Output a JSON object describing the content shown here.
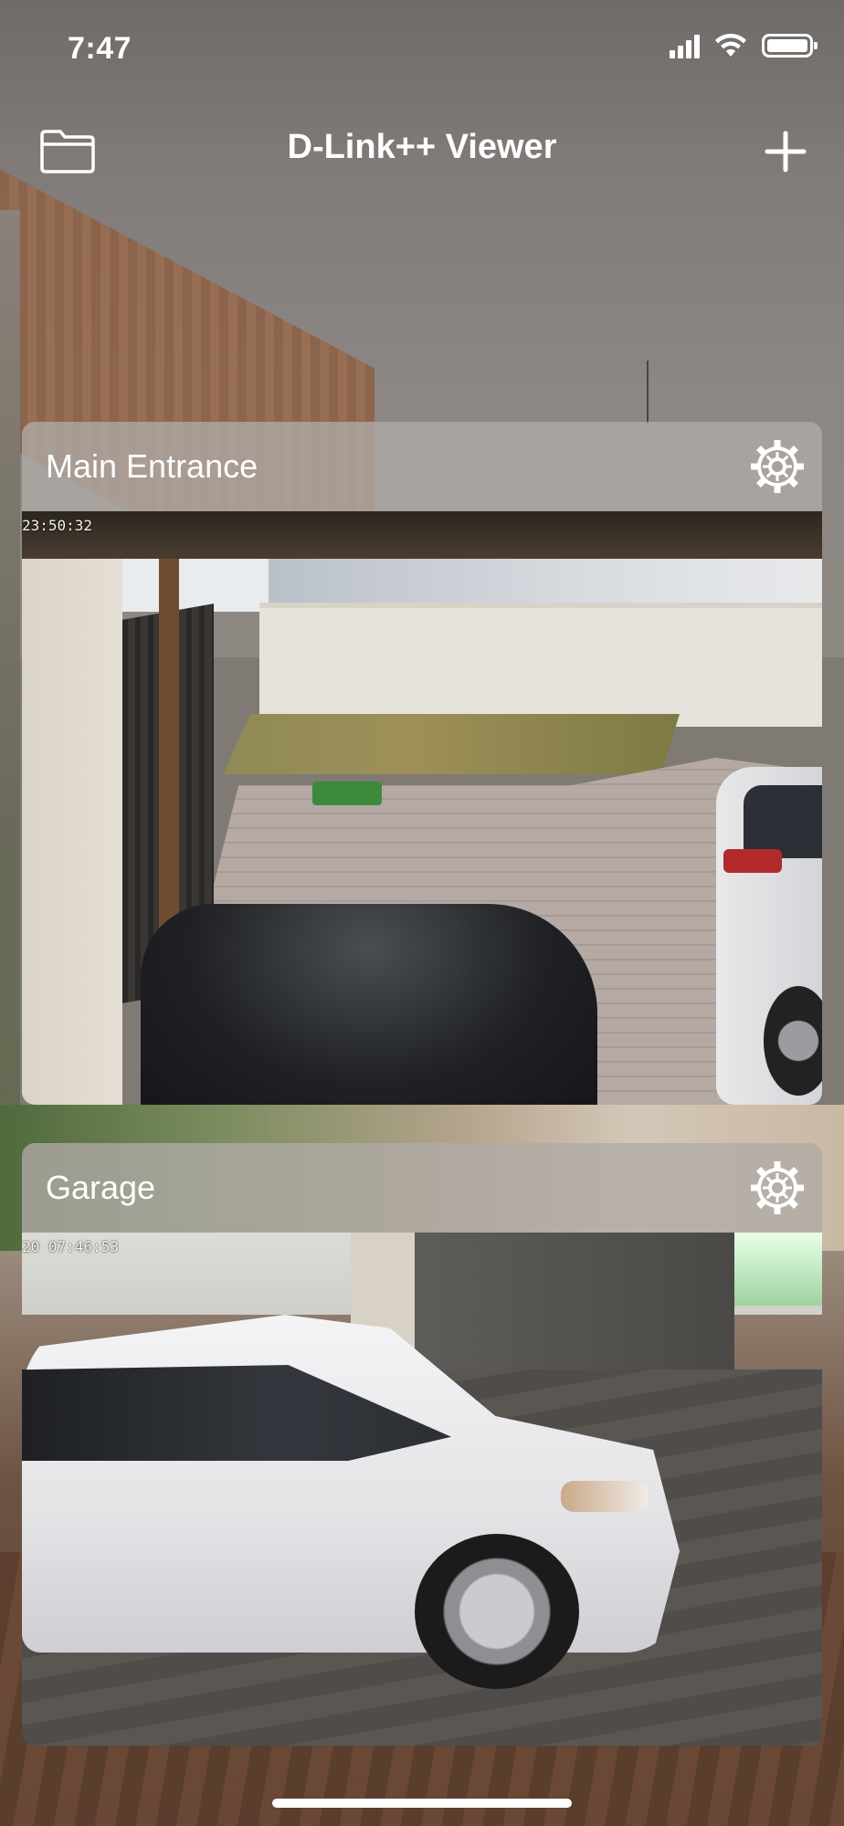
{
  "status_bar": {
    "time": "7:47"
  },
  "nav": {
    "title": "D-Link++ Viewer",
    "left_icon": "folder-icon",
    "right_icon": "plus-icon"
  },
  "cameras": [
    {
      "name": "Main Entrance",
      "timestamp": "23:50:32",
      "settings_icon": "gear-icon"
    },
    {
      "name": "Garage",
      "timestamp": "20 07:46:53",
      "settings_icon": "gear-icon"
    }
  ],
  "colors": {
    "text": "#ffffff",
    "card_header": "#afaaa7"
  }
}
